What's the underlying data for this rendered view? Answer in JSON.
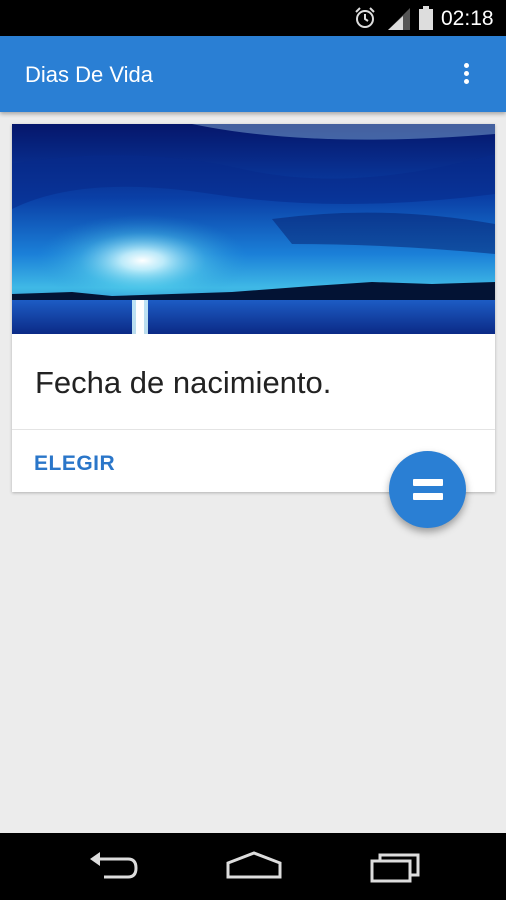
{
  "status_bar": {
    "time": "02:18",
    "icons": [
      "alarm-icon",
      "signal-icon",
      "battery-icon"
    ]
  },
  "app_bar": {
    "title": "Dias De Vida",
    "menu_icon": "more-vert-icon",
    "color": "#2a7fd4"
  },
  "card": {
    "image": "blue-sunset-lake-image",
    "title": "Fecha de nacimiento.",
    "action_label": "ELEGIR",
    "action_color": "#2a76c9"
  },
  "fab": {
    "icon": "equals-icon",
    "color": "#2a7fd4"
  },
  "nav_bar": {
    "buttons": [
      "back-icon",
      "home-icon",
      "recents-icon"
    ]
  }
}
